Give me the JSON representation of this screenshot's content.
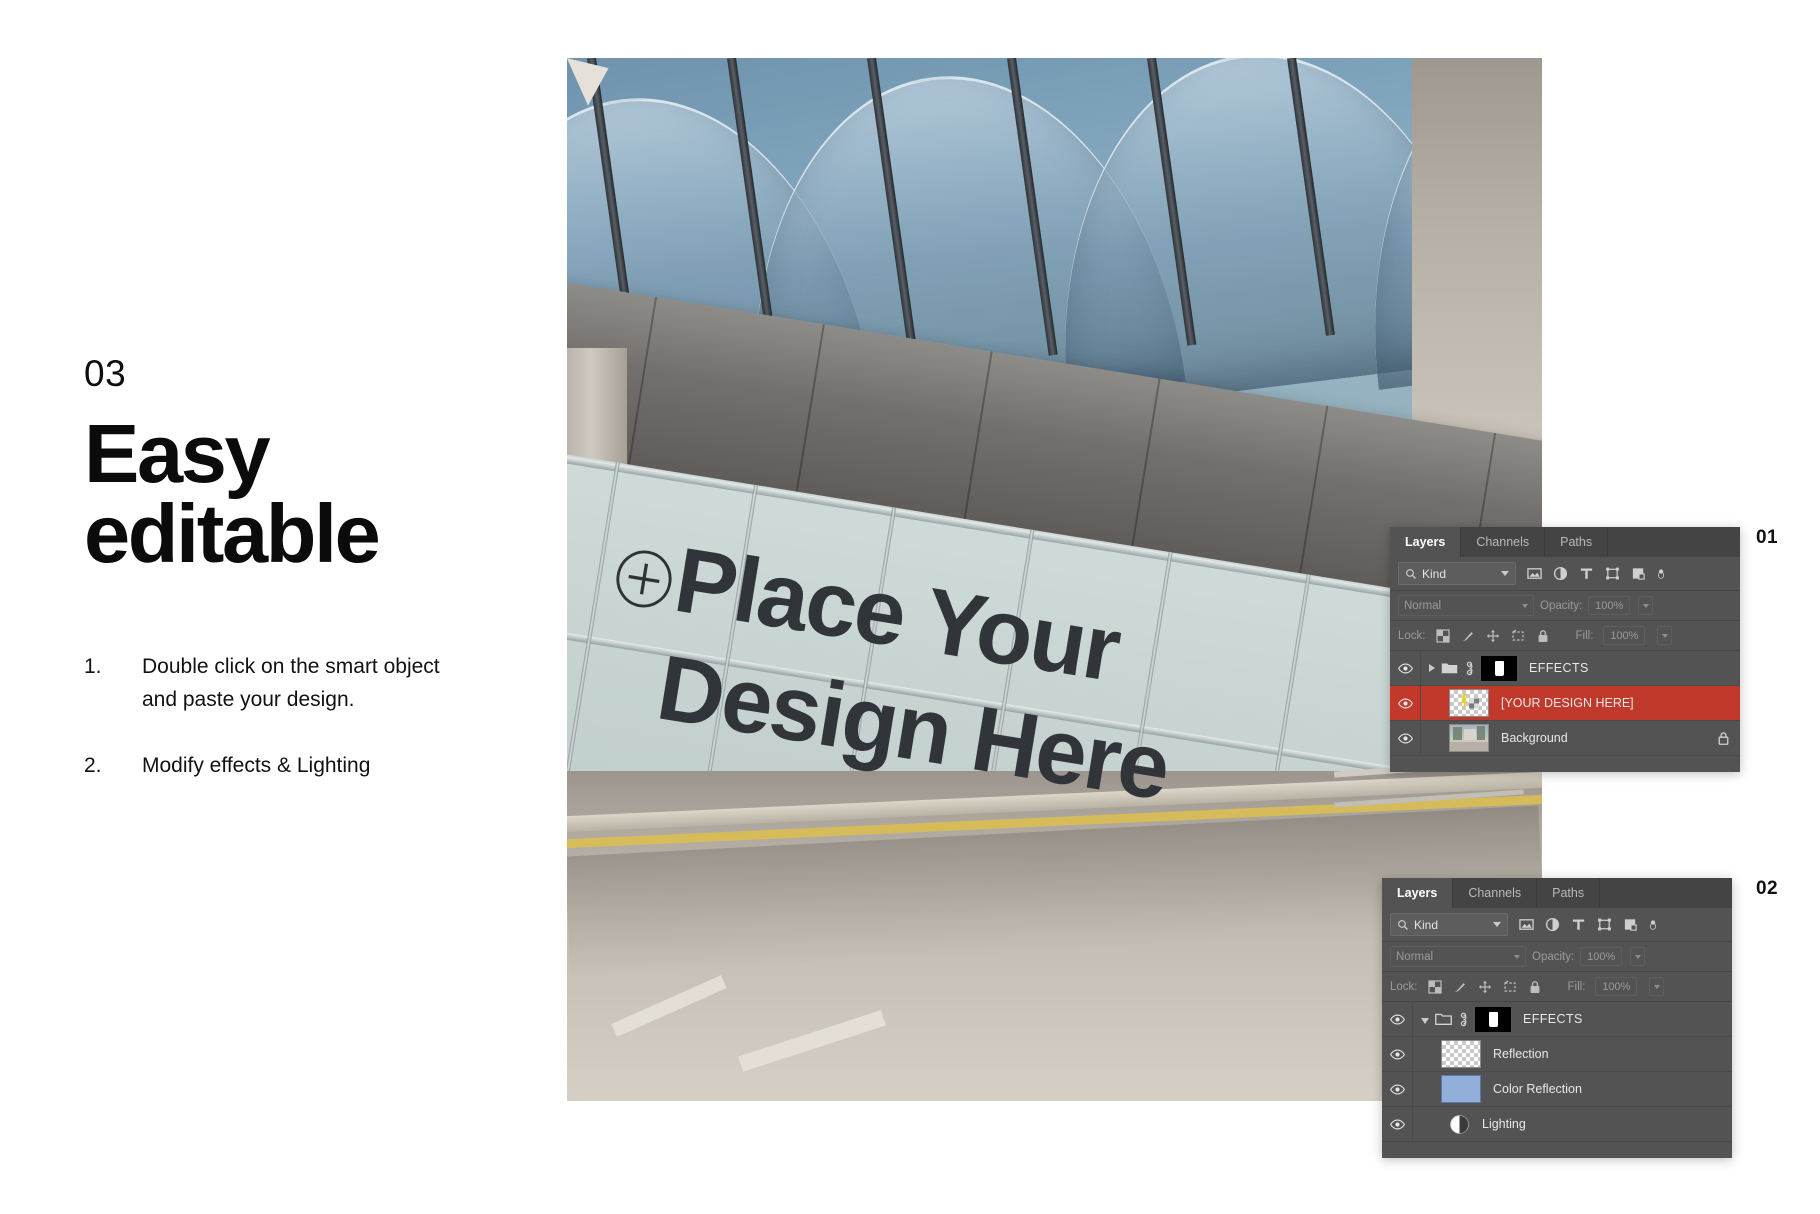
{
  "slide": {
    "step_number": "03",
    "headline_line1": "Easy",
    "headline_line2": "editable",
    "instructions": [
      {
        "index": "1.",
        "text": "Double click on the smart object and paste your design."
      },
      {
        "index": "2.",
        "text": "Modify effects & Lighting"
      }
    ]
  },
  "photo": {
    "overlay_line1": "Place Your",
    "overlay_line2": "Design Here",
    "target_icon": "circle-plus-icon",
    "description": "Glass facade of modern building with canopy and pavement"
  },
  "markers": {
    "panel1": "01",
    "panel2": "02"
  },
  "panel1": {
    "tabs": [
      {
        "label": "Layers",
        "active": true
      },
      {
        "label": "Channels",
        "active": false
      },
      {
        "label": "Paths",
        "active": false
      }
    ],
    "filter": {
      "kind_label": "Kind",
      "search_icon": "search-icon",
      "chevron_icon": "chevron-down-icon",
      "icons": [
        "image-filter-icon",
        "adjustment-filter-icon",
        "type-filter-icon",
        "shape-filter-icon",
        "smart-object-filter-icon",
        "toggle-filters-icon"
      ]
    },
    "blend": {
      "mode": "Normal",
      "opacity_label": "Opacity:",
      "opacity_value": "100%"
    },
    "lock": {
      "label": "Lock:",
      "icons": [
        "lock-transparent-pixels-icon",
        "lock-image-pixels-icon",
        "lock-position-icon",
        "lock-artboard-icon",
        "lock-all-icon"
      ],
      "fill_label": "Fill:",
      "fill_value": "100%"
    },
    "layers": [
      {
        "name": "EFFECTS",
        "type": "group",
        "expanded": false,
        "visible": true,
        "has_mask": true,
        "linked": true,
        "selected": false,
        "locked": false
      },
      {
        "name": "[YOUR DESIGN HERE]",
        "type": "smart-object",
        "visible": true,
        "thumbnail": "checker-smart-object",
        "selected": true,
        "locked": false
      },
      {
        "name": "Background",
        "type": "image",
        "visible": true,
        "thumbnail": "photo",
        "selected": false,
        "locked": true
      }
    ]
  },
  "panel2": {
    "tabs": [
      {
        "label": "Layers",
        "active": true
      },
      {
        "label": "Channels",
        "active": false
      },
      {
        "label": "Paths",
        "active": false
      }
    ],
    "filter": {
      "kind_label": "Kind",
      "search_icon": "search-icon",
      "chevron_icon": "chevron-down-icon",
      "icons": [
        "image-filter-icon",
        "adjustment-filter-icon",
        "type-filter-icon",
        "shape-filter-icon",
        "smart-object-filter-icon",
        "toggle-filters-icon"
      ]
    },
    "blend": {
      "mode": "Normal",
      "opacity_label": "Opacity:",
      "opacity_value": "100%"
    },
    "lock": {
      "label": "Lock:",
      "icons": [
        "lock-transparent-pixels-icon",
        "lock-image-pixels-icon",
        "lock-position-icon",
        "lock-artboard-icon",
        "lock-all-icon"
      ],
      "fill_label": "Fill:",
      "fill_value": "100%"
    },
    "layers": [
      {
        "name": "EFFECTS",
        "type": "group",
        "expanded": true,
        "visible": true,
        "has_mask": true,
        "linked": true,
        "selected": false,
        "locked": false
      },
      {
        "name": "Reflection",
        "type": "pixel",
        "visible": true,
        "thumbnail": "checker",
        "selected": false,
        "locked": false
      },
      {
        "name": "Color Reflection",
        "type": "pixel",
        "visible": true,
        "thumbnail": "solid-blue",
        "thumbnail_color": "#92aedb",
        "selected": false,
        "locked": false
      },
      {
        "name": "Lighting",
        "type": "adjustment",
        "visible": true,
        "thumbnail": "adjustment-half-circle",
        "selected": false,
        "locked": false
      }
    ]
  },
  "colors": {
    "panel_bg": "#535353",
    "panel_tabbar": "#444444",
    "selected_row": "#c0392b",
    "text_primary": "#e8e8e8",
    "text_muted": "#9a9a9a",
    "page_bg": "#ffffff",
    "heading": "#0b0b0b"
  }
}
